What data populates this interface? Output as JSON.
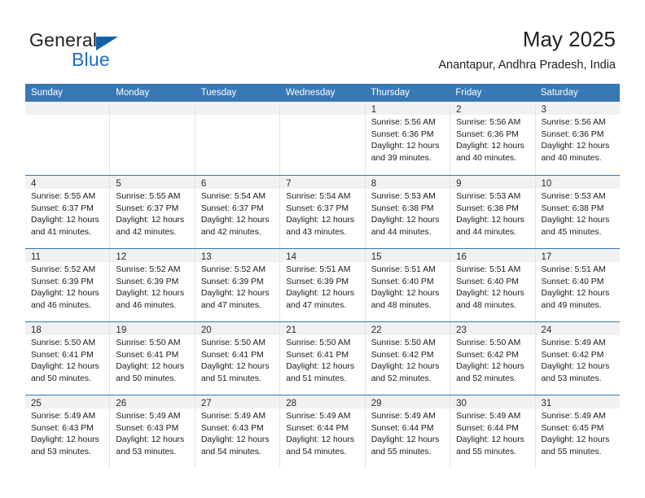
{
  "brand": {
    "name_top": "General",
    "name_bottom": "Blue",
    "accent_color": "#1261a8",
    "text_color": "#231f20"
  },
  "header": {
    "month_title": "May 2025",
    "location": "Anantapur, Andhra Pradesh, India"
  },
  "calendar": {
    "header_bg": "#3878b4",
    "weekdays": [
      "Sunday",
      "Monday",
      "Tuesday",
      "Wednesday",
      "Thursday",
      "Friday",
      "Saturday"
    ],
    "weeks": [
      [
        {
          "day": "",
          "lines": []
        },
        {
          "day": "",
          "lines": []
        },
        {
          "day": "",
          "lines": []
        },
        {
          "day": "",
          "lines": []
        },
        {
          "day": "1",
          "lines": [
            "Sunrise: 5:56 AM",
            "Sunset: 6:36 PM",
            "Daylight: 12 hours",
            "and 39 minutes."
          ]
        },
        {
          "day": "2",
          "lines": [
            "Sunrise: 5:56 AM",
            "Sunset: 6:36 PM",
            "Daylight: 12 hours",
            "and 40 minutes."
          ]
        },
        {
          "day": "3",
          "lines": [
            "Sunrise: 5:56 AM",
            "Sunset: 6:36 PM",
            "Daylight: 12 hours",
            "and 40 minutes."
          ]
        }
      ],
      [
        {
          "day": "4",
          "lines": [
            "Sunrise: 5:55 AM",
            "Sunset: 6:37 PM",
            "Daylight: 12 hours",
            "and 41 minutes."
          ]
        },
        {
          "day": "5",
          "lines": [
            "Sunrise: 5:55 AM",
            "Sunset: 6:37 PM",
            "Daylight: 12 hours",
            "and 42 minutes."
          ]
        },
        {
          "day": "6",
          "lines": [
            "Sunrise: 5:54 AM",
            "Sunset: 6:37 PM",
            "Daylight: 12 hours",
            "and 42 minutes."
          ]
        },
        {
          "day": "7",
          "lines": [
            "Sunrise: 5:54 AM",
            "Sunset: 6:37 PM",
            "Daylight: 12 hours",
            "and 43 minutes."
          ]
        },
        {
          "day": "8",
          "lines": [
            "Sunrise: 5:53 AM",
            "Sunset: 6:38 PM",
            "Daylight: 12 hours",
            "and 44 minutes."
          ]
        },
        {
          "day": "9",
          "lines": [
            "Sunrise: 5:53 AM",
            "Sunset: 6:38 PM",
            "Daylight: 12 hours",
            "and 44 minutes."
          ]
        },
        {
          "day": "10",
          "lines": [
            "Sunrise: 5:53 AM",
            "Sunset: 6:38 PM",
            "Daylight: 12 hours",
            "and 45 minutes."
          ]
        }
      ],
      [
        {
          "day": "11",
          "lines": [
            "Sunrise: 5:52 AM",
            "Sunset: 6:39 PM",
            "Daylight: 12 hours",
            "and 46 minutes."
          ]
        },
        {
          "day": "12",
          "lines": [
            "Sunrise: 5:52 AM",
            "Sunset: 6:39 PM",
            "Daylight: 12 hours",
            "and 46 minutes."
          ]
        },
        {
          "day": "13",
          "lines": [
            "Sunrise: 5:52 AM",
            "Sunset: 6:39 PM",
            "Daylight: 12 hours",
            "and 47 minutes."
          ]
        },
        {
          "day": "14",
          "lines": [
            "Sunrise: 5:51 AM",
            "Sunset: 6:39 PM",
            "Daylight: 12 hours",
            "and 47 minutes."
          ]
        },
        {
          "day": "15",
          "lines": [
            "Sunrise: 5:51 AM",
            "Sunset: 6:40 PM",
            "Daylight: 12 hours",
            "and 48 minutes."
          ]
        },
        {
          "day": "16",
          "lines": [
            "Sunrise: 5:51 AM",
            "Sunset: 6:40 PM",
            "Daylight: 12 hours",
            "and 48 minutes."
          ]
        },
        {
          "day": "17",
          "lines": [
            "Sunrise: 5:51 AM",
            "Sunset: 6:40 PM",
            "Daylight: 12 hours",
            "and 49 minutes."
          ]
        }
      ],
      [
        {
          "day": "18",
          "lines": [
            "Sunrise: 5:50 AM",
            "Sunset: 6:41 PM",
            "Daylight: 12 hours",
            "and 50 minutes."
          ]
        },
        {
          "day": "19",
          "lines": [
            "Sunrise: 5:50 AM",
            "Sunset: 6:41 PM",
            "Daylight: 12 hours",
            "and 50 minutes."
          ]
        },
        {
          "day": "20",
          "lines": [
            "Sunrise: 5:50 AM",
            "Sunset: 6:41 PM",
            "Daylight: 12 hours",
            "and 51 minutes."
          ]
        },
        {
          "day": "21",
          "lines": [
            "Sunrise: 5:50 AM",
            "Sunset: 6:41 PM",
            "Daylight: 12 hours",
            "and 51 minutes."
          ]
        },
        {
          "day": "22",
          "lines": [
            "Sunrise: 5:50 AM",
            "Sunset: 6:42 PM",
            "Daylight: 12 hours",
            "and 52 minutes."
          ]
        },
        {
          "day": "23",
          "lines": [
            "Sunrise: 5:50 AM",
            "Sunset: 6:42 PM",
            "Daylight: 12 hours",
            "and 52 minutes."
          ]
        },
        {
          "day": "24",
          "lines": [
            "Sunrise: 5:49 AM",
            "Sunset: 6:42 PM",
            "Daylight: 12 hours",
            "and 53 minutes."
          ]
        }
      ],
      [
        {
          "day": "25",
          "lines": [
            "Sunrise: 5:49 AM",
            "Sunset: 6:43 PM",
            "Daylight: 12 hours",
            "and 53 minutes."
          ]
        },
        {
          "day": "26",
          "lines": [
            "Sunrise: 5:49 AM",
            "Sunset: 6:43 PM",
            "Daylight: 12 hours",
            "and 53 minutes."
          ]
        },
        {
          "day": "27",
          "lines": [
            "Sunrise: 5:49 AM",
            "Sunset: 6:43 PM",
            "Daylight: 12 hours",
            "and 54 minutes."
          ]
        },
        {
          "day": "28",
          "lines": [
            "Sunrise: 5:49 AM",
            "Sunset: 6:44 PM",
            "Daylight: 12 hours",
            "and 54 minutes."
          ]
        },
        {
          "day": "29",
          "lines": [
            "Sunrise: 5:49 AM",
            "Sunset: 6:44 PM",
            "Daylight: 12 hours",
            "and 55 minutes."
          ]
        },
        {
          "day": "30",
          "lines": [
            "Sunrise: 5:49 AM",
            "Sunset: 6:44 PM",
            "Daylight: 12 hours",
            "and 55 minutes."
          ]
        },
        {
          "day": "31",
          "lines": [
            "Sunrise: 5:49 AM",
            "Sunset: 6:45 PM",
            "Daylight: 12 hours",
            "and 55 minutes."
          ]
        }
      ]
    ]
  }
}
